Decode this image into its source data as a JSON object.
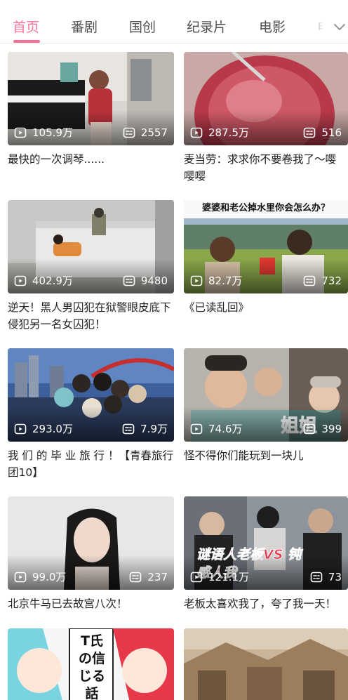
{
  "tabs": [
    {
      "label": "首页",
      "active": true
    },
    {
      "label": "番剧",
      "active": false
    },
    {
      "label": "国创",
      "active": false
    },
    {
      "label": "纪录片",
      "active": false
    },
    {
      "label": "电影",
      "active": false
    },
    {
      "label": "电",
      "active": false
    }
  ],
  "colors": {
    "accent": "#fb7299",
    "text": "#212121",
    "tab_text": "#505050"
  },
  "icons": {
    "views": "play-count-icon",
    "danmaku": "danmaku-count-icon",
    "more": "chevron-down-icon"
  },
  "videos": [
    {
      "views": "105.9万",
      "danmaku": "2557",
      "title": "最快的一次调琴......"
    },
    {
      "views": "287.5万",
      "danmaku": "516",
      "title": "麦当劳：求求你不要卷我了～嘤嘤嘤"
    },
    {
      "views": "402.9万",
      "danmaku": "9480",
      "title": "逆天！黑人男囚犯在狱警眼皮底下侵犯另一名女囚犯！"
    },
    {
      "views": "82.7万",
      "danmaku": "732",
      "title": "《已读乱回》",
      "thumb_caption": "婆婆和老公掉水里你会怎么办？"
    },
    {
      "views": "293.0万",
      "danmaku": "7.9万",
      "title": "我 们 的 毕 业 旅 行 ！【青春旅行团10】"
    },
    {
      "views": "74.6万",
      "danmaku": "399",
      "title": "怪不得你们能玩到一块儿",
      "thumb_caption": "姐姐"
    },
    {
      "views": "99.0万",
      "danmaku": "237",
      "title": "北京牛马已去故宫八次！"
    },
    {
      "views": "121.1万",
      "danmaku": "73",
      "title": "老板太喜欢我了，夸了我一天！",
      "thumb_caption": "谜语人老板VS 钝感人我"
    },
    {
      "views": "",
      "danmaku": "",
      "title": "",
      "thumb_caption": "T氏の信じる話"
    },
    {
      "views": "",
      "danmaku": "",
      "title": ""
    }
  ]
}
